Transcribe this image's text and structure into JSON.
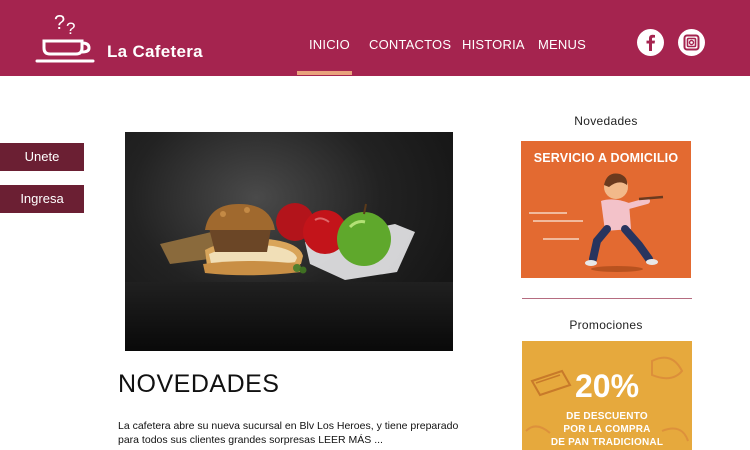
{
  "brand": {
    "name": "La Cafetera"
  },
  "nav": {
    "items": [
      {
        "label": "INICIO",
        "active": true
      },
      {
        "label": "CONTACTOS",
        "active": false
      },
      {
        "label": "HISTORIA",
        "active": false
      },
      {
        "label": "MENUS",
        "active": false
      }
    ]
  },
  "social": {
    "icons": [
      "facebook-icon",
      "instagram-icon"
    ]
  },
  "side": {
    "join_label": "Unete",
    "login_label": "Ingresa"
  },
  "main": {
    "title": "NOVEDADES",
    "body": "La cafetera abre su nueva sucursal en Blv Los Heroes, y tiene preparado para todos sus clientes grandes sorpresas",
    "read_more": "LEER MÁS ..."
  },
  "sidebar": {
    "news_title": "Novedades",
    "delivery_promo": "SERVICIO A DOMICILIO",
    "promos_title": "Promociones",
    "discount": {
      "percent": "20%",
      "line1": "DE DESCUENTO",
      "line2": "POR LA COMPRA",
      "line3": "DE PAN TRADICIONAL"
    }
  },
  "colors": {
    "header": "#a5244f",
    "side_button": "#6b1f33",
    "active_indicator": "#e8a27c",
    "delivery_bg": "#e36a31",
    "discount_bg": "#e6a93d"
  }
}
